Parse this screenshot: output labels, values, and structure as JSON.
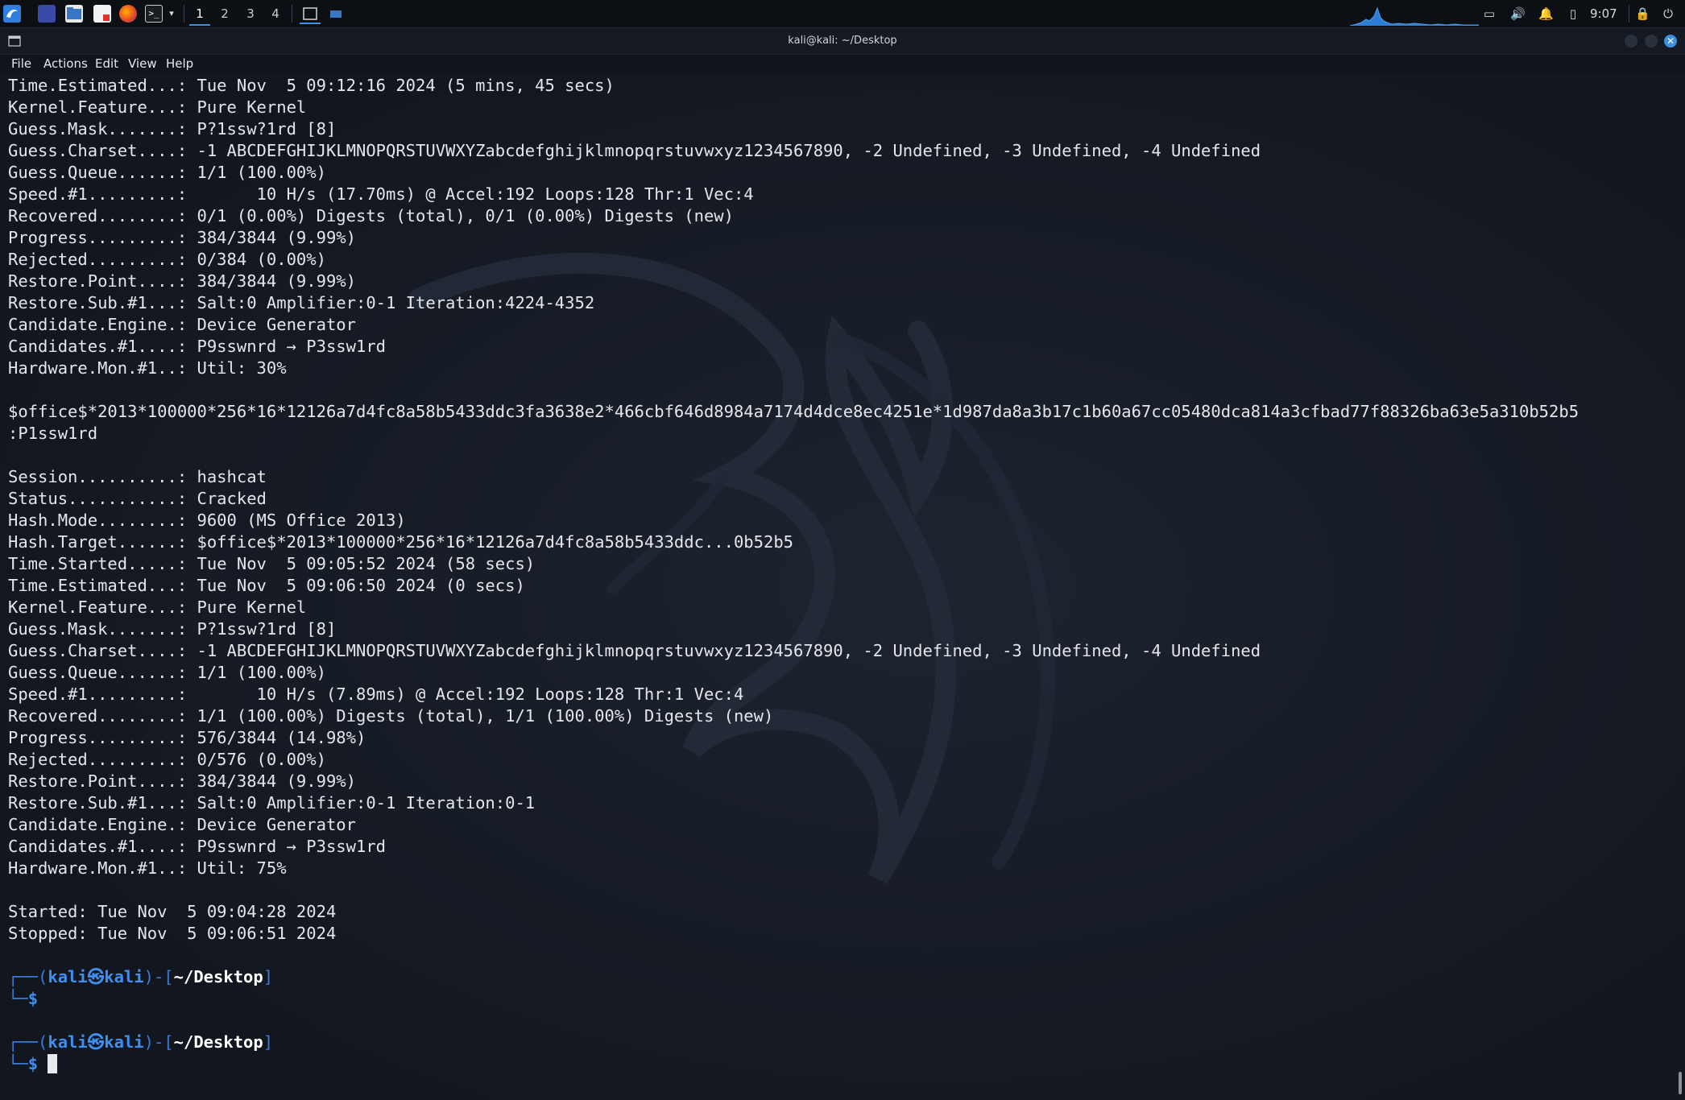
{
  "taskbar": {
    "workspaces": [
      "1",
      "2",
      "3",
      "4"
    ],
    "active_workspace": "1",
    "clock": "9:07"
  },
  "window": {
    "title": "kali@kali: ~/Desktop"
  },
  "menu": [
    "File",
    "Actions",
    "Edit",
    "View",
    "Help"
  ],
  "terminal": {
    "lines": [
      "Time.Estimated...: Tue Nov  5 09:12:16 2024 (5 mins, 45 secs)",
      "Kernel.Feature...: Pure Kernel",
      "Guess.Mask.......: P?1ssw?1rd [8]",
      "Guess.Charset....: -1 ABCDEFGHIJKLMNOPQRSTUVWXYZabcdefghijklmnopqrstuvwxyz1234567890, -2 Undefined, -3 Undefined, -4 Undefined",
      "Guess.Queue......: 1/1 (100.00%)",
      "Speed.#1.........:       10 H/s (17.70ms) @ Accel:192 Loops:128 Thr:1 Vec:4",
      "Recovered........: 0/1 (0.00%) Digests (total), 0/1 (0.00%) Digests (new)",
      "Progress.........: 384/3844 (9.99%)",
      "Rejected.........: 0/384 (0.00%)",
      "Restore.Point....: 384/3844 (9.99%)",
      "Restore.Sub.#1...: Salt:0 Amplifier:0-1 Iteration:4224-4352",
      "Candidate.Engine.: Device Generator",
      "Candidates.#1....: P9sswnrd → P3ssw1rd",
      "Hardware.Mon.#1..: Util: 30%",
      "",
      "$office$*2013*100000*256*16*12126a7d4fc8a58b5433ddc3fa3638e2*466cbf646d8984a7174d4dce8ec4251e*1d987da8a3b17c1b60a67cc05480dca814a3cfbad77f88326ba63e5a310b52b5",
      ":P1ssw1rd",
      "",
      "Session..........: hashcat",
      "Status...........: Cracked",
      "Hash.Mode........: 9600 (MS Office 2013)",
      "Hash.Target......: $office$*2013*100000*256*16*12126a7d4fc8a58b5433ddc...0b52b5",
      "Time.Started.....: Tue Nov  5 09:05:52 2024 (58 secs)",
      "Time.Estimated...: Tue Nov  5 09:06:50 2024 (0 secs)",
      "Kernel.Feature...: Pure Kernel",
      "Guess.Mask.......: P?1ssw?1rd [8]",
      "Guess.Charset....: -1 ABCDEFGHIJKLMNOPQRSTUVWXYZabcdefghijklmnopqrstuvwxyz1234567890, -2 Undefined, -3 Undefined, -4 Undefined",
      "Guess.Queue......: 1/1 (100.00%)",
      "Speed.#1.........:       10 H/s (7.89ms) @ Accel:192 Loops:128 Thr:1 Vec:4",
      "Recovered........: 1/1 (100.00%) Digests (total), 1/1 (100.00%) Digests (new)",
      "Progress.........: 576/3844 (14.98%)",
      "Rejected.........: 0/576 (0.00%)",
      "Restore.Point....: 384/3844 (9.99%)",
      "Restore.Sub.#1...: Salt:0 Amplifier:0-1 Iteration:0-1",
      "Candidate.Engine.: Device Generator",
      "Candidates.#1....: P9sswnrd → P3ssw1rd",
      "Hardware.Mon.#1..: Util: 75%",
      "",
      "Started: Tue Nov  5 09:04:28 2024",
      "Stopped: Tue Nov  5 09:06:51 2024",
      ""
    ],
    "prompt": {
      "top_open": "┌──(",
      "user": "kali㉿kali",
      "mid": ")-[",
      "path": "~/Desktop",
      "close": "]",
      "bottom": "└─",
      "sign": "$"
    }
  },
  "colors": {
    "terminal_bg": "#141a24",
    "text": "#e4e6ea",
    "prompt_blue": "#3f8ff0",
    "accent": "#3d8fe0"
  },
  "icons": [
    "kali-menu-icon",
    "desktop-icon",
    "file-manager-icon",
    "text-editor-icon",
    "firefox-icon",
    "terminal-icon",
    "window-list-icon",
    "display-icon",
    "volume-icon",
    "notification-icon",
    "battery-icon",
    "lock-icon",
    "power-icon"
  ]
}
